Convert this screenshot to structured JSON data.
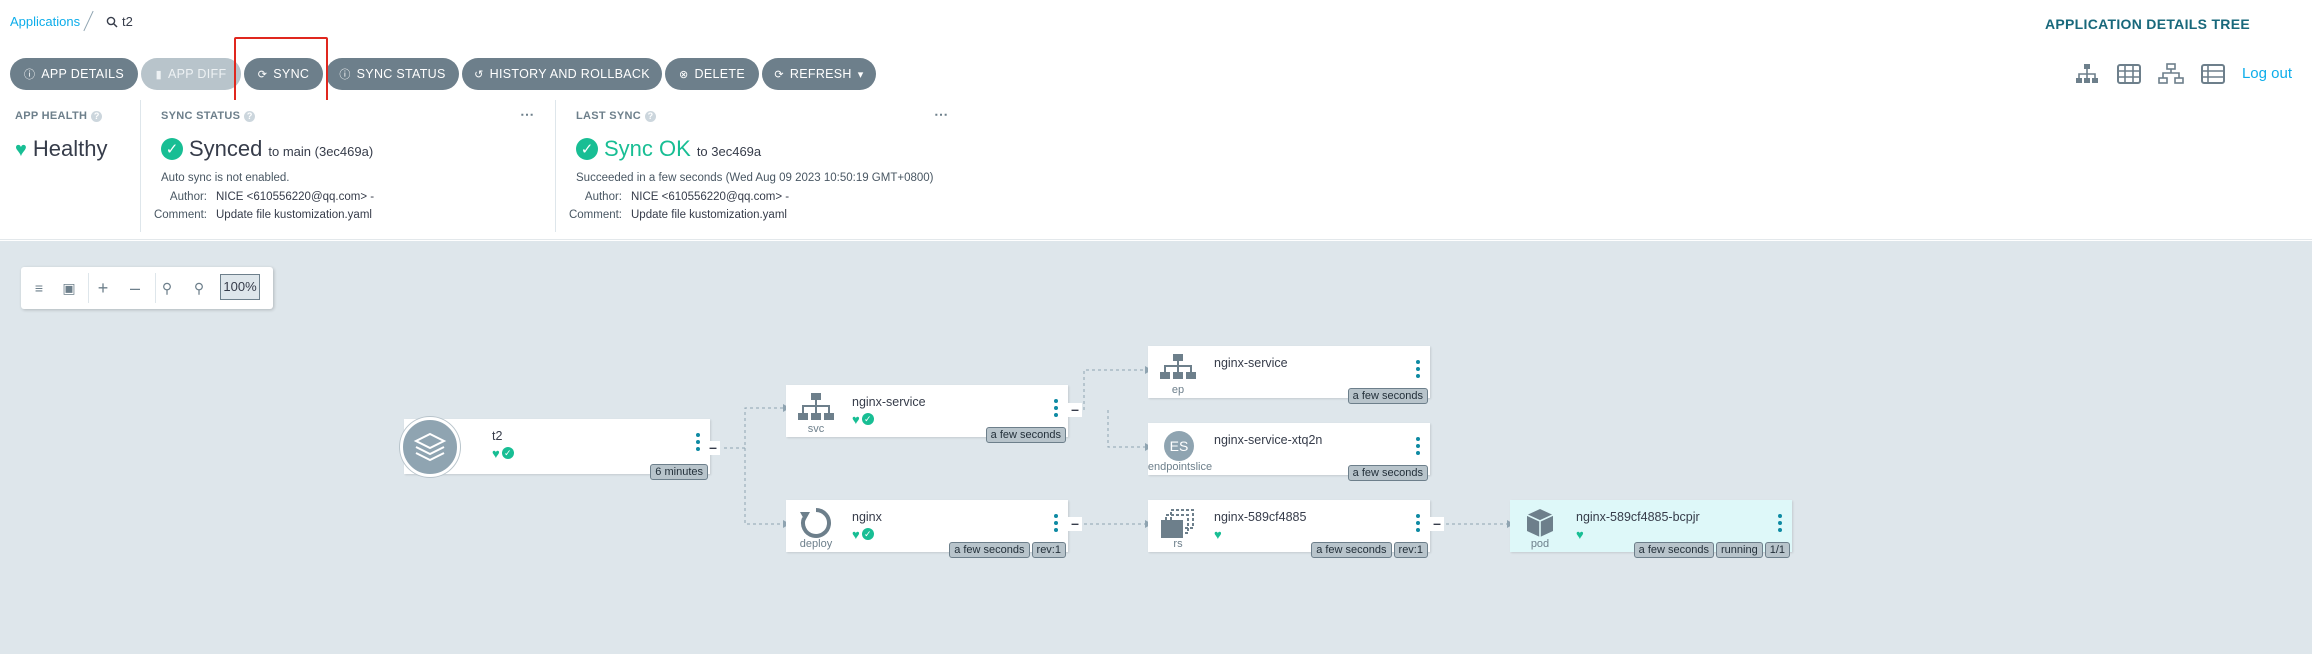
{
  "breadcrumb": {
    "applications_label": "Applications",
    "search_value": "t2"
  },
  "page_heading": "APPLICATION DETAILS TREE",
  "toolbar": {
    "buttons": [
      {
        "label": "APP DETAILS",
        "icon": "info-icon"
      },
      {
        "label": "APP DIFF",
        "icon": "file-icon"
      },
      {
        "label": "SYNC",
        "icon": "sync-icon"
      },
      {
        "label": "SYNC STATUS",
        "icon": "info-icon"
      },
      {
        "label": "HISTORY AND ROLLBACK",
        "icon": "history-icon"
      },
      {
        "label": "DELETE",
        "icon": "delete-icon"
      },
      {
        "label": "REFRESH",
        "icon": "refresh-icon"
      }
    ],
    "logout_label": "Log out",
    "view_icons": [
      "tree-view-icon",
      "pods-view-icon",
      "network-view-icon",
      "list-view-icon"
    ]
  },
  "app_health": {
    "title": "APP HEALTH",
    "status": "Healthy"
  },
  "sync_status": {
    "title": "SYNC STATUS",
    "status": "Synced",
    "target": "to main (3ec469a)",
    "auto_sync": "Auto sync is not enabled.",
    "author_label": "Author:",
    "author": "NICE <610556220@qq.com> -",
    "comment_label": "Comment:",
    "comment": "Update file kustomization.yaml"
  },
  "last_sync": {
    "title": "LAST SYNC",
    "status": "Sync OK",
    "target": "to 3ec469a",
    "detail": "Succeeded in a few seconds (Wed Aug 09 2023 10:50:19 GMT+0800)",
    "author_label": "Author:",
    "author": "NICE <610556220@qq.com> -",
    "comment_label": "Comment:",
    "comment": "Update file kustomization.yaml"
  },
  "zoom": {
    "level": "100%"
  },
  "tree": {
    "app": {
      "name": "t2",
      "age": "6 minutes"
    },
    "svc": {
      "name": "nginx-service",
      "type": "svc",
      "age": "a few seconds"
    },
    "deploy": {
      "name": "nginx",
      "type": "deploy",
      "age": "a few seconds",
      "rev": "rev:1"
    },
    "ep": {
      "name": "nginx-service",
      "type": "ep",
      "age": "a few seconds"
    },
    "es": {
      "name": "nginx-service-xtq2n",
      "type": "endpointslice",
      "badge": "ES",
      "age": "a few seconds"
    },
    "rs": {
      "name": "nginx-589cf4885",
      "type": "rs",
      "age": "a few seconds",
      "rev": "rev:1"
    },
    "pod": {
      "name": "nginx-589cf4885-bcpjr",
      "type": "pod",
      "age": "a few seconds",
      "state": "running",
      "ready": "1/1"
    }
  },
  "colors": {
    "accent": "#0dadea",
    "healthy": "#18be94",
    "button": "#6d7f8b",
    "highlight": "#e0271e",
    "canvas": "#dee6eb"
  }
}
